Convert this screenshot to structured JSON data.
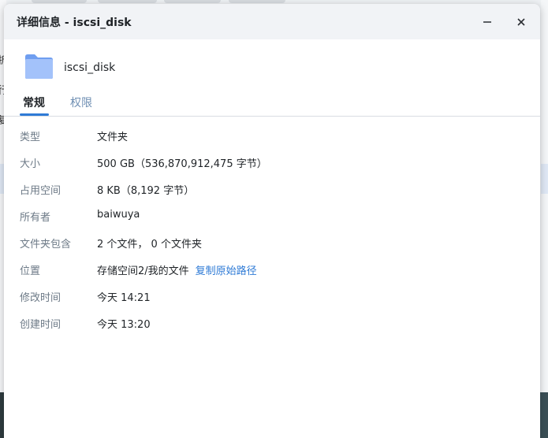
{
  "window": {
    "title": "详细信息 - iscsi_disk",
    "minimize_glyph": "—",
    "close_glyph": "✕"
  },
  "header": {
    "icon": "folder-icon",
    "name": "iscsi_disk"
  },
  "tabs": [
    {
      "label": "常规",
      "active": true
    },
    {
      "label": "权限",
      "active": false
    }
  ],
  "properties": {
    "type": {
      "label": "类型",
      "value": "文件夹"
    },
    "size": {
      "label": "大小",
      "value": "500 GB（536,870,912,475 字节）"
    },
    "used": {
      "label": "占用空间",
      "value": "8 KB（8,192 字节）"
    },
    "owner": {
      "label": "所有者",
      "value": "baiwuya"
    },
    "contains": {
      "label": "文件夹包含",
      "value": "2 个文件， 0 个文件夹"
    },
    "location": {
      "label": "位置",
      "value": "存储空间2/我的文件",
      "link": "复制原始路径"
    },
    "modified": {
      "label": "修改时间",
      "value": "今天 14:21"
    },
    "created": {
      "label": "创建时间",
      "value": "今天 13:20"
    }
  },
  "background": {
    "left_chars": [
      "折",
      "行",
      "复"
    ]
  },
  "colors": {
    "accent": "#2f7bd6",
    "folder": "#8fb4f5",
    "label": "#6d7a87",
    "titlebar": "#f1f3f6"
  }
}
